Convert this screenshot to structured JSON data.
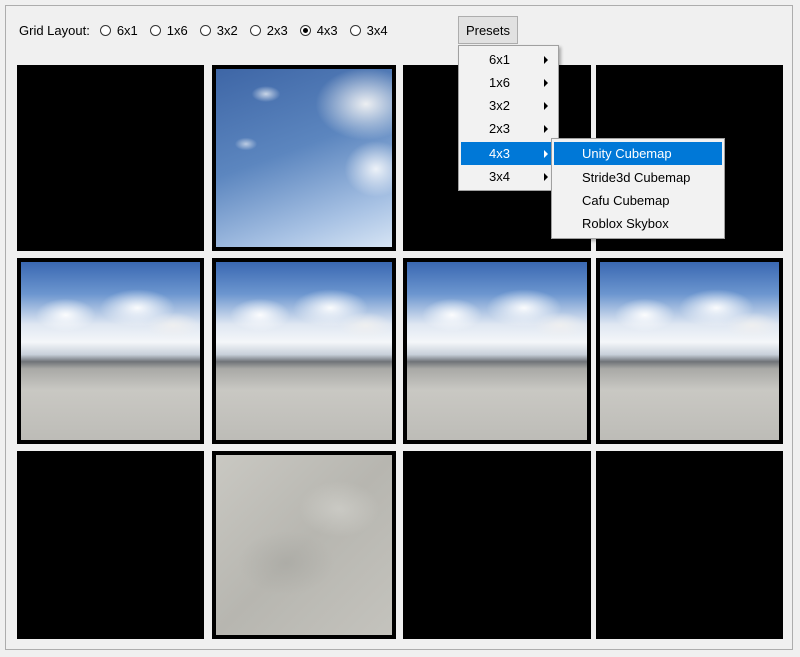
{
  "toolbar": {
    "grid_layout_label": "Grid Layout:",
    "options": [
      {
        "label": "6x1",
        "checked": false
      },
      {
        "label": "1x6",
        "checked": false
      },
      {
        "label": "3x2",
        "checked": false
      },
      {
        "label": "2x3",
        "checked": false
      },
      {
        "label": "4x3",
        "checked": true
      },
      {
        "label": "3x4",
        "checked": false
      }
    ],
    "presets_label": "Presets"
  },
  "presets_menu": {
    "items": [
      "6x1",
      "1x6",
      "3x2",
      "2x3",
      "4x3",
      "3x4"
    ],
    "highlighted": "4x3"
  },
  "submenu_4x3": {
    "items": [
      "Unity Cubemap",
      "Stride3d Cubemap",
      "Cafu Cubemap",
      "Roblox Skybox"
    ],
    "highlighted": "Unity Cubemap"
  },
  "grid": {
    "columns": 4,
    "rows": 3,
    "cells": [
      [
        "empty",
        "sky",
        "empty",
        "empty"
      ],
      [
        "side",
        "side",
        "side",
        "side"
      ],
      [
        "empty",
        "floor",
        "empty",
        "empty"
      ]
    ]
  },
  "colors": {
    "highlight": "#0078d7",
    "background": "#f0f0f0",
    "empty_cell": "#000000"
  }
}
